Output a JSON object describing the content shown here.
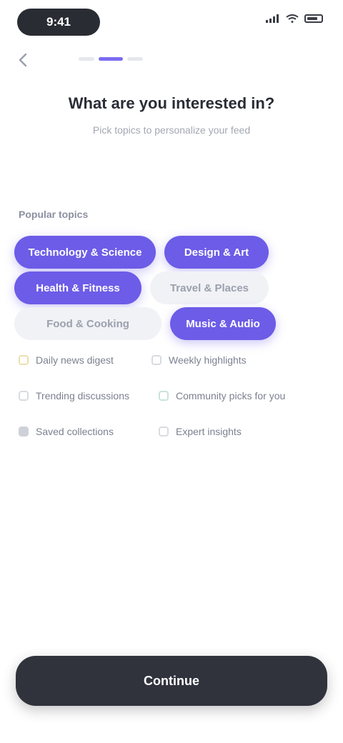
{
  "status_bar": {
    "time": "9:41",
    "icons": [
      "signal-icon",
      "wifi-icon",
      "battery-icon"
    ]
  },
  "nav": {
    "back_icon": "chevron-left-icon",
    "total_steps": 3,
    "current_step": 2
  },
  "heading": {
    "title": "What are you interested in?",
    "subtitle": "Pick topics to personalize your feed"
  },
  "section_label": "Popular topics",
  "chips": [
    {
      "label": "Technology & Science",
      "selected": true
    },
    {
      "label": "Design & Art",
      "selected": true
    },
    {
      "label": "Health & Fitness",
      "selected": true
    },
    {
      "label": "Travel & Places",
      "selected": false
    },
    {
      "label": "Food & Cooking",
      "selected": false
    },
    {
      "label": "Music & Audio",
      "selected": true
    }
  ],
  "checklist": [
    {
      "label": "Daily news digest",
      "style": "warm"
    },
    {
      "label": "Weekly highlights",
      "style": "plain"
    },
    {
      "label": "Trending discussions",
      "style": "plain"
    },
    {
      "label": "Community picks for you",
      "style": "cool"
    },
    {
      "label": "Saved collections",
      "style": "filled"
    },
    {
      "label": "Expert insights",
      "style": "plain"
    }
  ],
  "cta": {
    "label": "Continue"
  },
  "colors": {
    "accent": "#6c5ce7",
    "chip_unselected": "#f1f2f6",
    "cta_background": "#30333c"
  }
}
